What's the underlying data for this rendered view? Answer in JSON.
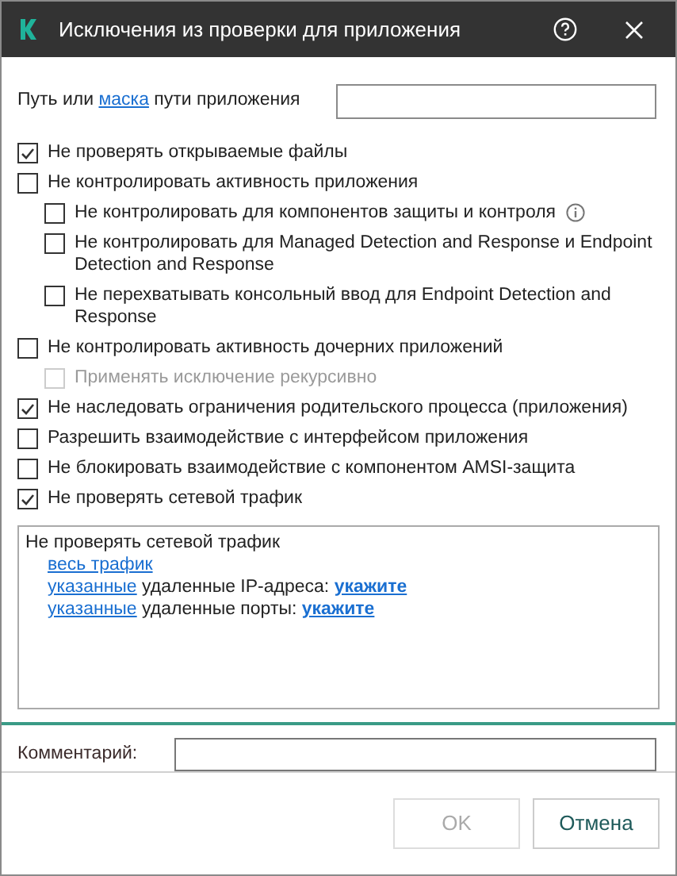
{
  "window": {
    "title": "Исключения из проверки для приложения"
  },
  "path_field": {
    "label_parts": [
      {
        "kind": "text",
        "text": "Путь или "
      },
      {
        "kind": "link",
        "text": "маска"
      },
      {
        "kind": "text",
        "text": " пути приложения"
      }
    ]
  },
  "options": [
    {
      "label": "Не проверять открываемые файлы",
      "checked": true,
      "disabled": false,
      "info_icon": false
    },
    {
      "label": "Не контролировать активность приложения",
      "checked": false,
      "disabled": false,
      "info_icon": false,
      "children": [
        {
          "label": "Не контролировать для компонентов защиты и контроля",
          "checked": false,
          "disabled": false,
          "info_icon": true
        },
        {
          "label": "Не контролировать для Managed Detection and Response и Endpoint Detection and Response",
          "checked": false,
          "disabled": false,
          "info_icon": false
        },
        {
          "label": "Не перехватывать консольный ввод для Endpoint Detection and Response",
          "checked": false,
          "disabled": false,
          "info_icon": false
        }
      ]
    },
    {
      "label": "Не контролировать активность дочерних приложений",
      "checked": false,
      "disabled": false,
      "info_icon": false,
      "children": [
        {
          "label": "Применять исключение рекурсивно",
          "checked": false,
          "disabled": true,
          "info_icon": false
        }
      ]
    },
    {
      "label": "Не наследовать ограничения родительского процесса (приложения)",
      "checked": true,
      "disabled": false,
      "info_icon": false
    },
    {
      "label": "Разрешить взаимодействие с интерфейсом приложения",
      "checked": false,
      "disabled": false,
      "info_icon": false
    },
    {
      "label": "Не блокировать взаимодействие с компонентом AMSI-защита",
      "checked": false,
      "disabled": false,
      "info_icon": false
    },
    {
      "label": "Не проверять сетевой трафик",
      "checked": true,
      "disabled": false,
      "info_icon": false
    }
  ],
  "traffic_box": {
    "title": "Не проверять сетевой трафик",
    "lines": [
      [
        {
          "kind": "link",
          "text": "весь трафик"
        }
      ],
      [
        {
          "kind": "link",
          "text": "указанные"
        },
        {
          "kind": "text",
          "text": " удаленные IP-адреса: "
        },
        {
          "kind": "bold_link",
          "text": "укажите"
        }
      ],
      [
        {
          "kind": "link",
          "text": "указанные"
        },
        {
          "kind": "text",
          "text": " удаленные порты: "
        },
        {
          "kind": "bold_link",
          "text": "укажите"
        }
      ]
    ]
  },
  "comment_field": {
    "label": "Комментарий:"
  },
  "buttons": [
    {
      "label": "OK",
      "disabled": true
    },
    {
      "label": "Отмена",
      "disabled": false
    }
  ]
}
